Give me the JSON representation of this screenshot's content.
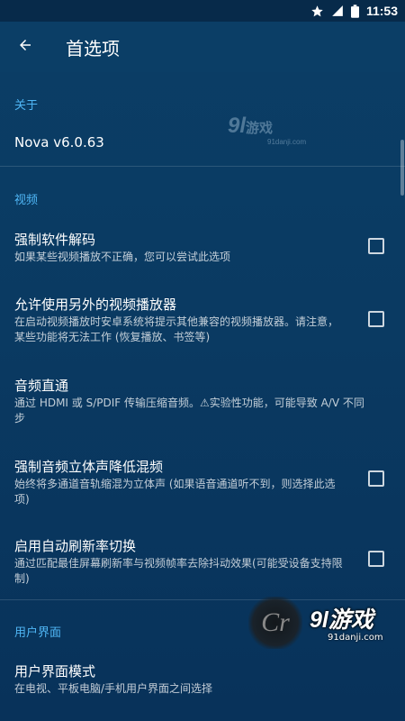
{
  "status_bar": {
    "time": "11:53",
    "icons": [
      "star-icon",
      "signal-icon",
      "battery-icon"
    ]
  },
  "app_bar": {
    "back_icon": "back-arrow-icon",
    "title": "首选项"
  },
  "sections": {
    "about": {
      "header": "关于",
      "version": "Nova v6.0.63"
    },
    "video": {
      "header": "视频",
      "items": [
        {
          "title": "强制软件解码",
          "summary": "如果某些视频播放不正确，您可以尝试此选项",
          "checked": false
        },
        {
          "title": "允许使用另外的视频播放器",
          "summary": "在启动视频播放时安卓系统将提示其他兼容的视频播放器。请注意，某些功能将无法工作 (恢复播放、书签等)",
          "checked": false
        },
        {
          "title": "音频直通",
          "summary": "通过 HDMI 或 S/PDIF 传输压缩音频。⚠实验性功能，可能导致 A/V 不同步"
        },
        {
          "title": "强制音频立体声降低混频",
          "summary": "始终将多通道音轨缩混为立体声 (如果语音通道听不到，则选择此选项)",
          "checked": false
        },
        {
          "title": "启用自动刷新率切换",
          "summary": "通过匹配最佳屏幕刷新率与视频帧率去除抖动效果(可能受设备支持限制)",
          "checked": false
        }
      ]
    },
    "ui": {
      "header": "用户界面",
      "items": [
        {
          "title": "用户界面模式",
          "summary": "在电视、平板电脑/手机用户界面之间选择"
        }
      ]
    }
  },
  "watermarks": {
    "top_logo": "9l",
    "top_cn": "游戏",
    "top_site": "91danji.com",
    "bottom_logo": "9l游戏",
    "bottom_site": "91danji.com",
    "cr_text": "Cr"
  },
  "colors": {
    "background": "#0b3e66",
    "accent": "#4fb6f5",
    "status_bar": "#072a4a"
  }
}
